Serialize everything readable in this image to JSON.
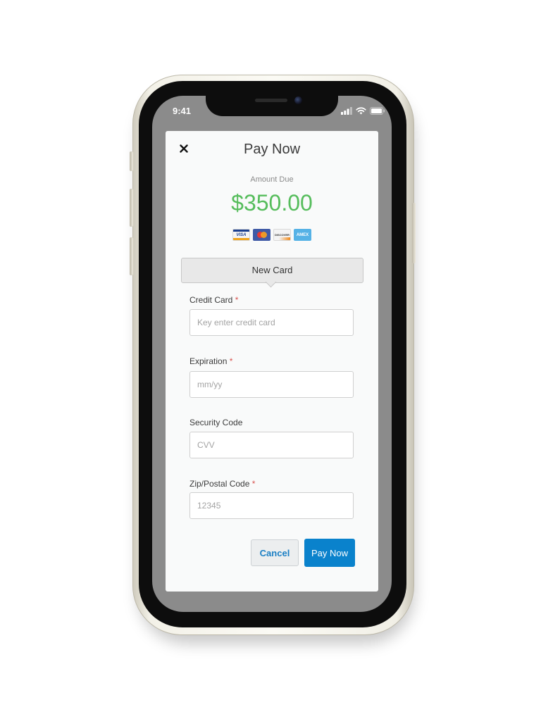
{
  "status_bar": {
    "time": "9:41"
  },
  "modal": {
    "title": "Pay Now",
    "amount_label": "Amount Due",
    "amount_value": "$350.00",
    "accepted_cards": [
      "visa",
      "mastercard",
      "discover",
      "amex"
    ],
    "card_logo_text": {
      "visa": "VISA",
      "discover": "DISCOVER",
      "amex": "AMEX"
    },
    "tab_label": "New Card",
    "fields": {
      "credit_card": {
        "label": "Credit Card",
        "required": "*",
        "placeholder": "Key enter credit card",
        "value": ""
      },
      "expiration": {
        "label": "Expiration",
        "required": "*",
        "placeholder": "mm/yy",
        "value": ""
      },
      "security_code": {
        "label": "Security Code",
        "placeholder": "CVV",
        "value": ""
      },
      "zip": {
        "label": "Zip/Postal Code",
        "required": "*",
        "placeholder": "12345",
        "value": ""
      }
    },
    "buttons": {
      "cancel": "Cancel",
      "pay": "Pay Now"
    }
  },
  "colors": {
    "amount": "#56bd5c",
    "primary": "#0a82cc",
    "cancel_text": "#1b7fc4",
    "required": "#d9534f",
    "overlay": "#8b8b8b"
  }
}
